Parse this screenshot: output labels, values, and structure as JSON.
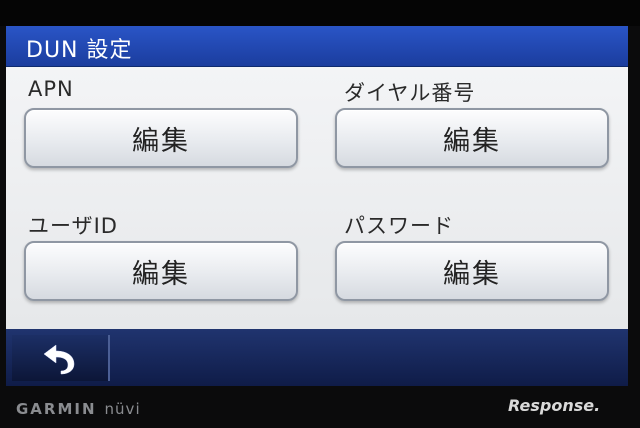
{
  "title": "DUN 設定",
  "fields": [
    {
      "label": "APN",
      "button": "編集"
    },
    {
      "label": "ダイヤル番号",
      "button": "編集"
    },
    {
      "label": "ユーザID",
      "button": "編集"
    },
    {
      "label": "パスワード",
      "button": "編集"
    }
  ],
  "nav": {
    "back_icon": "back-arrow-icon"
  },
  "device": {
    "brand": "GARMIN",
    "model": "nüvi"
  },
  "watermark": "Response."
}
